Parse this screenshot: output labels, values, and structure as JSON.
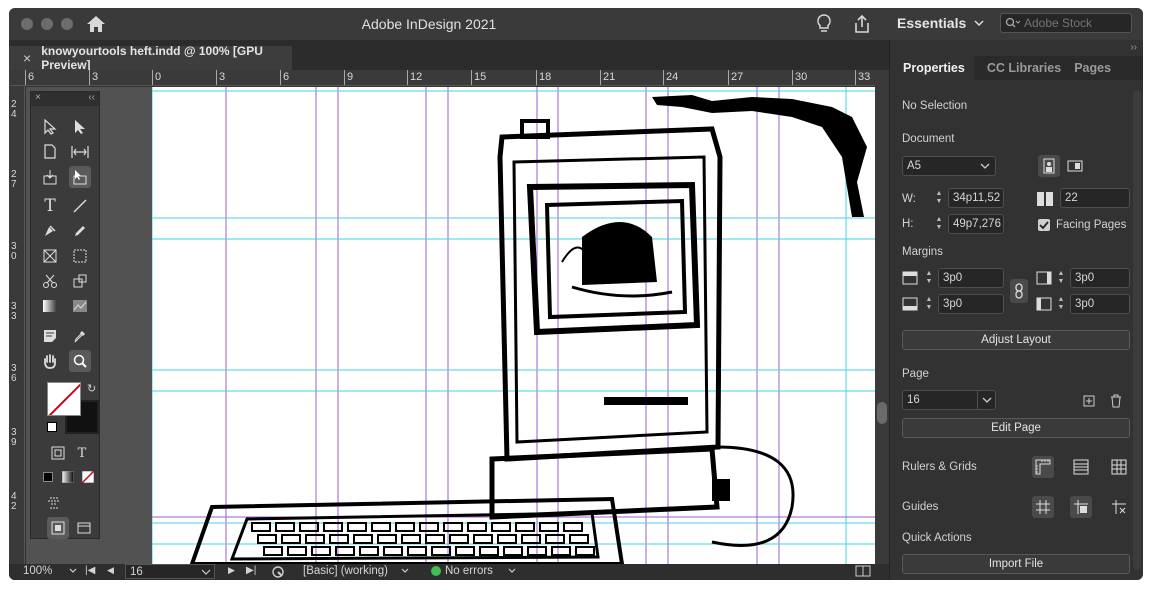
{
  "window": {
    "title": "Adobe InDesign 2021",
    "workspace": "Essentials",
    "stock_placeholder": "Adobe Stock"
  },
  "document_tab": {
    "close": "×",
    "label": "knowyourtools heft.indd @ 100% [GPU Preview]"
  },
  "ruler": {
    "horizontal": [
      "6",
      "3",
      "0",
      "3",
      "6",
      "9",
      "12",
      "15",
      "18",
      "21",
      "24",
      "27",
      "30",
      "33"
    ],
    "vertical": [
      [
        "2",
        "4"
      ],
      [
        "2",
        "7"
      ],
      [
        "3",
        "0"
      ],
      [
        "3",
        "3"
      ],
      [
        "3",
        "6"
      ],
      [
        "3",
        "9"
      ],
      [
        "4",
        "2"
      ]
    ]
  },
  "tools_panel": {
    "close": "×",
    "collapse": "‹‹"
  },
  "status_bar": {
    "zoom": "100%",
    "page": "16",
    "style": "[Basic] (working)",
    "preflight": "No errors",
    "preflight_color": "#3fbf4f"
  },
  "properties": {
    "tabs": [
      "Properties",
      "CC Libraries",
      "Pages"
    ],
    "selection": "No Selection",
    "document_heading": "Document",
    "preset": "A5",
    "width_label": "W:",
    "width": "34p11,52",
    "height_label": "H:",
    "height": "49p7,276",
    "pages_count": "22",
    "facing_pages_label": "Facing Pages",
    "facing_pages": true,
    "margins_heading": "Margins",
    "margin_top": "3p0",
    "margin_bottom": "3p0",
    "margin_inside": "3p0",
    "margin_outside": "3p0",
    "adjust_layout": "Adjust Layout",
    "page_heading": "Page",
    "page_number": "16",
    "edit_page": "Edit Page",
    "rulers_grids": "Rulers & Grids",
    "guides": "Guides",
    "quick_actions": "Quick Actions",
    "import_file": "Import File"
  },
  "colors": {
    "chrome": "#323232",
    "guide_purple": "#9a5fc8",
    "guide_cyan": "#46d3dc",
    "accent_red": "#d0021b"
  }
}
